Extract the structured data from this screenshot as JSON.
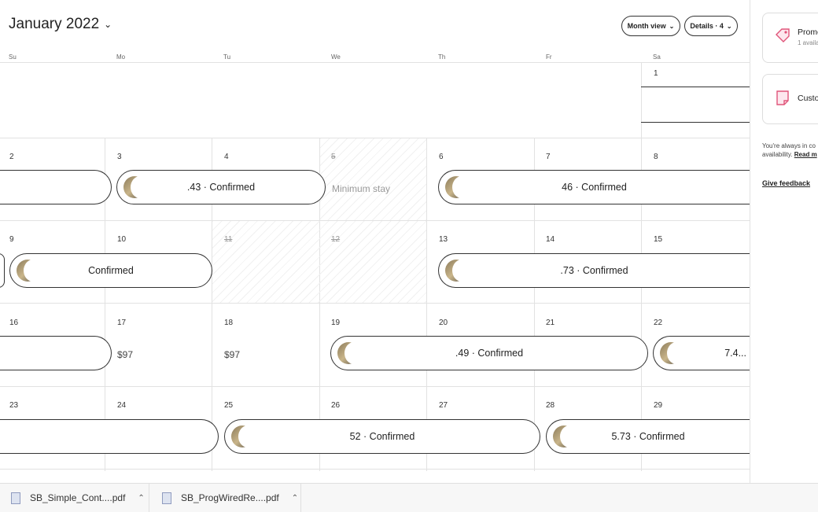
{
  "header": {
    "month": "January 2022",
    "month_view_label": "Month view",
    "details_label": "Details · 4"
  },
  "weekdays": [
    "Su",
    "Mo",
    "Tu",
    "We",
    "Th",
    "Fr",
    "Sa"
  ],
  "days": {
    "d1": "1",
    "d2": "2",
    "d3": "3",
    "d4": "4",
    "d5": "5",
    "d6": "6",
    "d7": "7",
    "d8": "8",
    "d9": "9",
    "d10": "10",
    "d11": "11",
    "d12": "12",
    "d13": "13",
    "d14": "14",
    "d15": "15",
    "d16": "16",
    "d17": "17",
    "d18": "18",
    "d19": "19",
    "d20": "20",
    "d21": "21",
    "d22": "22",
    "d23": "23",
    "d24": "24",
    "d25": "25",
    "d26": "26",
    "d27": "27",
    "d28": "28",
    "d29": "29"
  },
  "cells": {
    "minimum_stay": "Minimum stay",
    "price_17": "$97",
    "price_18": "$97"
  },
  "reservations": {
    "r1": "",
    "r2": ".43 · Confirmed",
    "r3": "46 · Confirmed",
    "r4": "",
    "r5": "Confirmed",
    "r6": ".73 · Confirmed",
    "r7": "",
    "r8": ".49 · Confirmed",
    "r9": "7.4...",
    "r10": "",
    "r11": "52 · Confirmed",
    "r12": "5.73 · Confirmed"
  },
  "sidebar": {
    "promo_title": "Promo",
    "promo_sub": "1 availa",
    "custom_title": "Custo",
    "note_line1": "You're always in co",
    "note_line2": "availability.",
    "read_more": "Read m",
    "feedback": "Give feedback"
  },
  "downloads": [
    {
      "name": "SB_Simple_Cont....pdf"
    },
    {
      "name": "SB_ProgWiredRe....pdf"
    }
  ],
  "colors": {
    "border": "#333333",
    "grid": "#e2e2e2",
    "promo_icon": "#e0557a"
  }
}
